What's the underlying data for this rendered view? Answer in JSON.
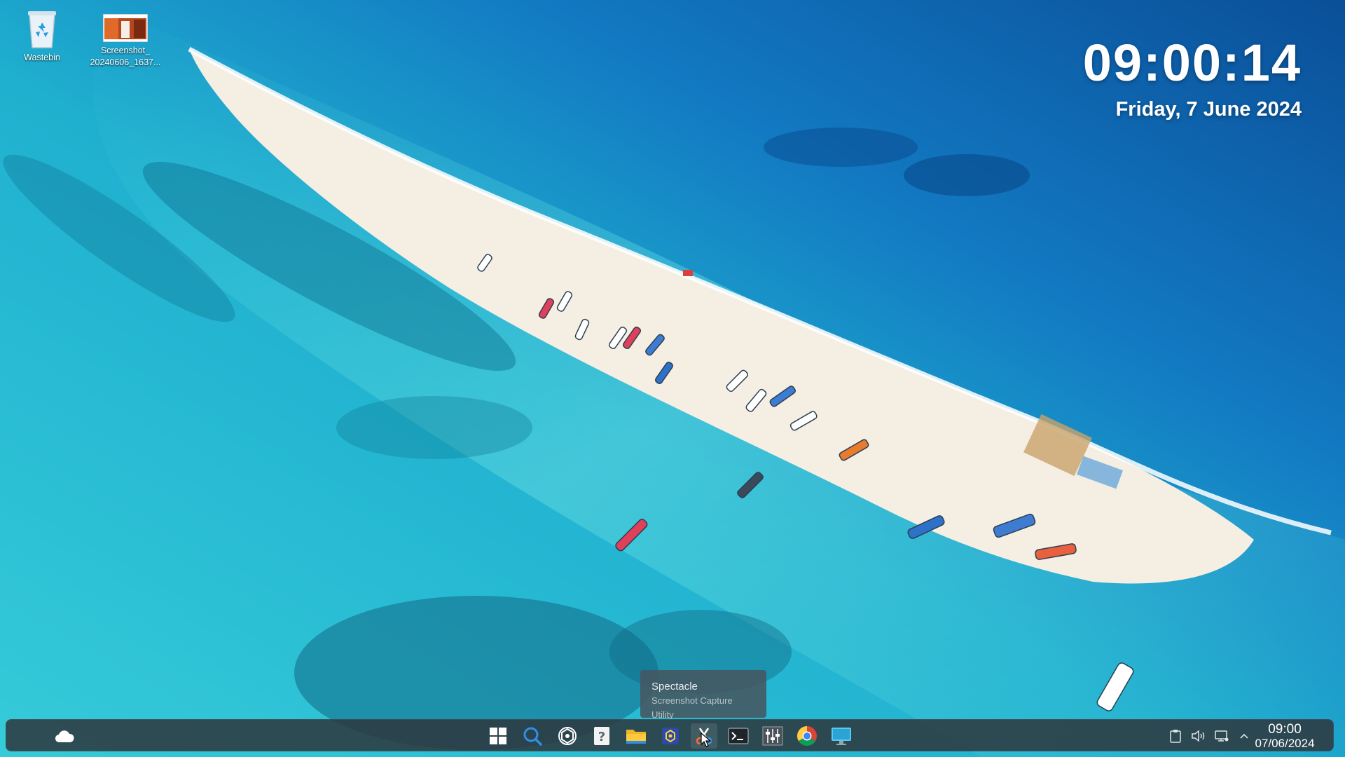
{
  "desktop": {
    "icons": [
      {
        "label": "Wastebin",
        "icon": "recycle-bin-icon"
      },
      {
        "label_line1": "Screenshot_",
        "label_line2": "20240606_1637...",
        "icon": "image-file-icon"
      }
    ]
  },
  "clock_widget": {
    "time": "09:00:14",
    "date": "Friday, 7 June 2024"
  },
  "tooltip": {
    "title": "Spectacle",
    "subtitle": "Screenshot Capture Utility"
  },
  "taskbar": {
    "weather_icon": "cloud-icon",
    "apps": [
      {
        "name": "start-menu",
        "icon": "windows-logo-icon"
      },
      {
        "name": "search",
        "icon": "search-icon"
      },
      {
        "name": "chatgpt",
        "icon": "openai-icon"
      },
      {
        "name": "help",
        "icon": "help-document-icon"
      },
      {
        "name": "file-manager",
        "icon": "folder-icon"
      },
      {
        "name": "kde-connect",
        "icon": "hexagon-app-icon"
      },
      {
        "name": "spectacle",
        "icon": "scissors-icon"
      },
      {
        "name": "terminal",
        "icon": "terminal-icon"
      },
      {
        "name": "system-monitor",
        "icon": "mixer-icon"
      },
      {
        "name": "chrome",
        "icon": "chrome-icon"
      },
      {
        "name": "remote-desktop",
        "icon": "monitor-icon"
      }
    ],
    "tray": [
      {
        "name": "clipboard",
        "icon": "clipboard-icon"
      },
      {
        "name": "volume",
        "icon": "speaker-icon"
      },
      {
        "name": "network",
        "icon": "network-icon"
      },
      {
        "name": "show-hidden",
        "icon": "chevron-up-icon"
      }
    ],
    "clock": {
      "time": "09:00",
      "date": "07/06/2024"
    }
  },
  "colors": {
    "taskbar_bg": "#2d373c",
    "sea_deep": "#0a5fb0",
    "sea_shallow": "#2ec5d6",
    "sand": "#f3ede2"
  }
}
